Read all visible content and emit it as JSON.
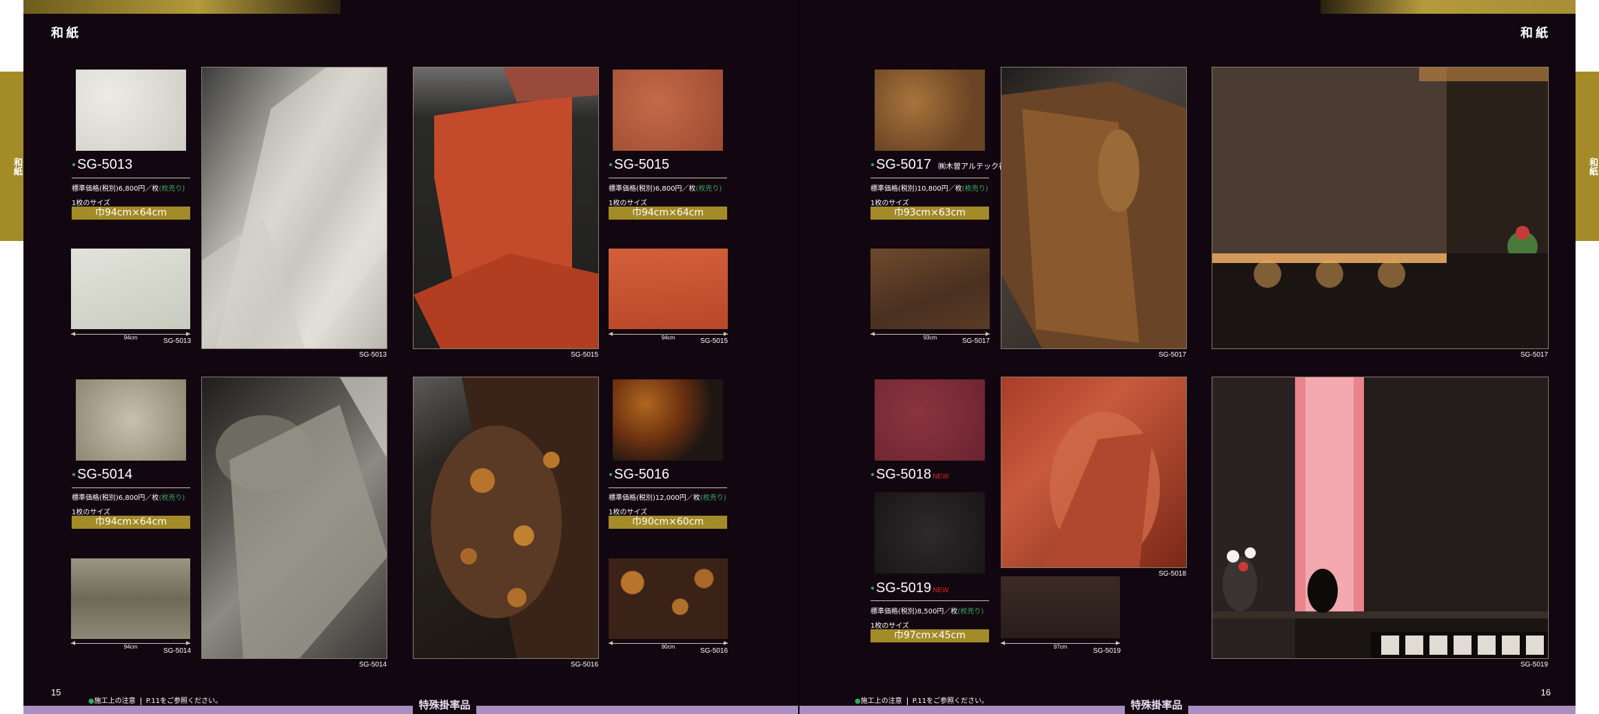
{
  "left_page": {
    "section_title": "和紙",
    "side_tab": "和紙",
    "page_number": "15",
    "footnote": {
      "label": "施工上の注意",
      "ref": "P.11をご参照ください。"
    },
    "bottom_badge": "特殊掛率品"
  },
  "right_page": {
    "section_title": "和紙",
    "side_tab": "和紙",
    "page_number": "16",
    "footnote": {
      "label": "施工上の注意",
      "ref": "P.11をご参照ください。"
    },
    "bottom_badge": "特殊掛率品"
  },
  "products": [
    {
      "code": "SG-5013",
      "price": "標準価格(税別)6,800円／枚",
      "unit": "(枚売り)",
      "size_label": "1枚のサイズ",
      "size": "巾94cm×64cm",
      "measure": "94cm",
      "caption": "SG-5013",
      "photo_caption": "SG-5013",
      "swatch_color": "#dedbd4",
      "swatch_color_2": "#d6d8cc"
    },
    {
      "code": "SG-5014",
      "price": "標準価格(税別)6,800円／枚",
      "unit": "(枚売り)",
      "size_label": "1枚のサイズ",
      "size": "巾94cm×64cm",
      "measure": "94cm",
      "caption": "SG-5014",
      "photo_caption": "SG-5014",
      "swatch_color": "#bdb5a2",
      "swatch_color_2": "#8a8570"
    },
    {
      "code": "SG-5015",
      "price": "標準価格(税別)6,800円／枚",
      "unit": "(枚売り)",
      "size_label": "1枚のサイズ",
      "size": "巾94cm×64cm",
      "measure": "94cm",
      "caption": "SG-5015",
      "photo_caption": "SG-5015",
      "swatch_color": "#b8583a",
      "swatch_color_2": "#c2502c"
    },
    {
      "code": "SG-5016",
      "price": "標準価格(税別)12,000円／枚",
      "unit": "(枚売り)",
      "size_label": "1枚のサイズ",
      "size": "巾90cm×60cm",
      "measure": "90cm",
      "caption": "SG-5016",
      "photo_caption": "SG-5016",
      "swatch_color": "#6a3a18",
      "swatch_color_2": "#4a2a16"
    },
    {
      "code": "SG-5017",
      "maker": "㈱木曽アルテック社",
      "price": "標準価格(税別)10,800円／枚",
      "unit": "(枚売り)",
      "size_label": "1枚のサイズ",
      "size": "巾93cm×63cm",
      "measure": "93cm",
      "caption": "SG-5017",
      "photo_caption": "SG-5017",
      "room_caption": "SG-5017",
      "swatch_color": "#8a5a30",
      "swatch_color_2": "#5a3a22"
    },
    {
      "code": "SG-5018",
      "new": "NEW",
      "photo_caption": "SG-5018",
      "swatch_color": "#7a2b34"
    },
    {
      "code": "SG-5019",
      "new": "NEW",
      "price": "標準価格(税別)8,500円／枚",
      "unit": "(枚売り)",
      "size_label": "1枚のサイズ",
      "size": "巾97cm×45cm",
      "measure": "97cm",
      "caption": "SG-5019",
      "room_caption": "SG-5019",
      "swatch_color": "#282426",
      "swatch_color_2": "#3a2a26"
    }
  ]
}
